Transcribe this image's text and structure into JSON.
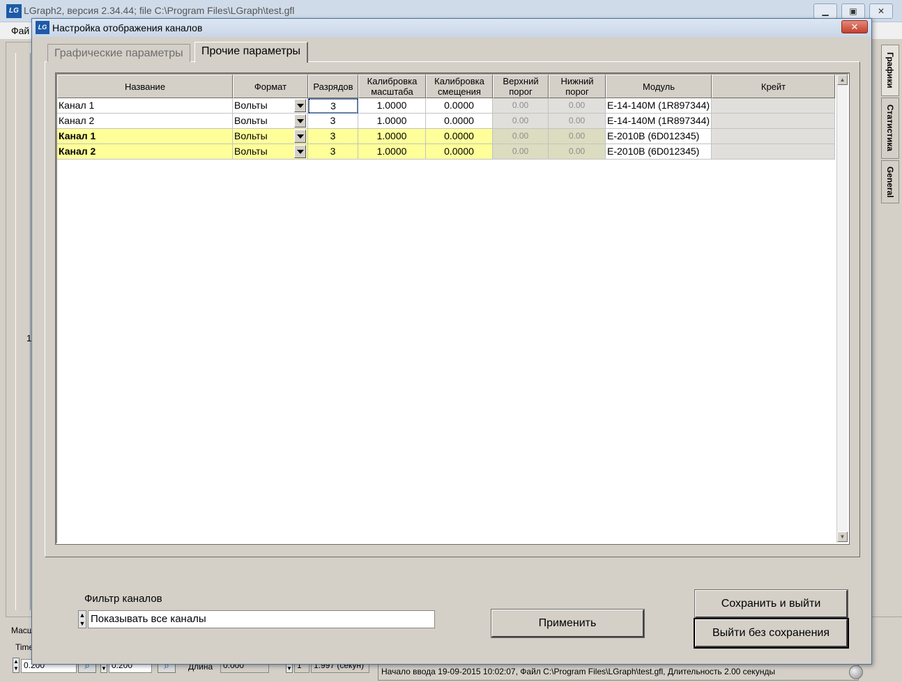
{
  "main_window": {
    "logo": "LG",
    "title": "LGraph2, версия  2.34.44; file C:\\Program Files\\LGraph\\test.gfl",
    "menu_file": "Фай",
    "minimize": "▁",
    "maximize": "▣",
    "close": "✕",
    "left_value": "1",
    "side_tabs": [
      "Графики",
      "Статистика",
      "General"
    ],
    "bottom": {
      "scale_label": "Масш",
      "time_label": "Time",
      "time_value": "0.200",
      "second_value": "0.200",
      "length_label": "Длина",
      "length_value": "0.000",
      "count_value": "1",
      "duration_value": "1.997 (секун)",
      "zoom_icon": "⌕"
    },
    "status_text": "Начало ввода   19-09-2015 10:02:07, Файл C:\\Program Files\\LGraph\\test.gfl, Длительность 2.00 секунды"
  },
  "dialog": {
    "logo": "LG",
    "title": "Настройка отображения каналов",
    "close": "✕",
    "tabs": [
      {
        "label": "Графические параметры",
        "active": false
      },
      {
        "label": "Прочие параметры",
        "active": true
      }
    ],
    "columns": [
      "Название",
      "Формат",
      "Разрядов",
      "Калибровка масштаба",
      "Калибровка смещения",
      "Верхний порог",
      "Нижний порог",
      "Модуль",
      "Крейт"
    ],
    "rows": [
      {
        "name": "Канал 1",
        "format": "Вольты",
        "digits": "3",
        "scale": "1.0000",
        "offset": "0.0000",
        "upper": "0.00",
        "lower": "0.00",
        "module": "E-14-140M (1R897344)",
        "crate": ""
      },
      {
        "name": "Канал 2",
        "format": "Вольты",
        "digits": "3",
        "scale": "1.0000",
        "offset": "0.0000",
        "upper": "0.00",
        "lower": "0.00",
        "module": "E-14-140M (1R897344)",
        "crate": ""
      },
      {
        "name": "Канал 1",
        "format": "Вольты",
        "digits": "3",
        "scale": "1.0000",
        "offset": "0.0000",
        "upper": "0.00",
        "lower": "0.00",
        "module": "E-2010B (6D012345)",
        "crate": ""
      },
      {
        "name": "Канал 2",
        "format": "Вольты",
        "digits": "3",
        "scale": "1.0000",
        "offset": "0.0000",
        "upper": "0.00",
        "lower": "0.00",
        "module": "E-2010B (6D012345)",
        "crate": ""
      }
    ],
    "scroll_up": "▲",
    "scroll_down": "▼",
    "filter_label": "Фильтр каналов",
    "filter_value": "Показывать все каналы",
    "btn_apply": "Применить",
    "btn_save": "Сохранить и выйти",
    "btn_exit": "Выйти без сохранения",
    "highlight_color": "#ffff99"
  }
}
